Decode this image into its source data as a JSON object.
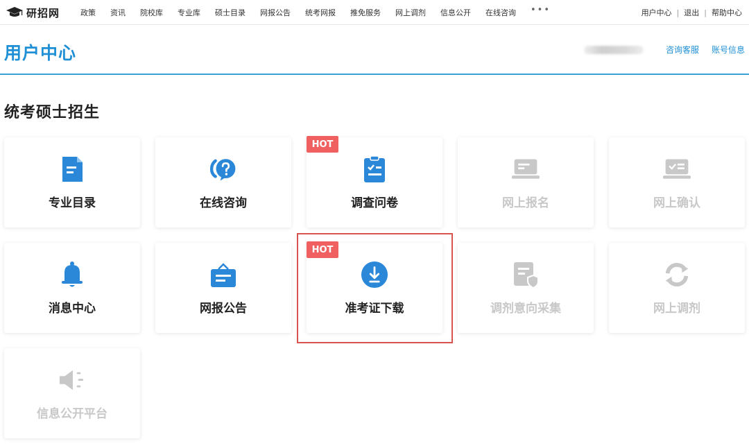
{
  "topnav": {
    "logo_text": "研招网",
    "items": [
      "政策",
      "资讯",
      "院校库",
      "专业库",
      "硕士目录",
      "网报公告",
      "统考网报",
      "推免服务",
      "网上调剂",
      "信息公开",
      "在线咨询"
    ],
    "more": "•••",
    "right": [
      "用户中心",
      "退出",
      "帮助中心"
    ],
    "separator": "|"
  },
  "header": {
    "title": "用户中心",
    "links": [
      "咨询客服",
      "账号信息"
    ]
  },
  "section": {
    "title": "统考硕士招生"
  },
  "cards": [
    {
      "label": "专业目录",
      "icon": "document-icon",
      "enabled": true,
      "hot": false
    },
    {
      "label": "在线咨询",
      "icon": "question-chat-icon",
      "enabled": true,
      "hot": false
    },
    {
      "label": "调查问卷",
      "icon": "clipboard-check-icon",
      "enabled": true,
      "hot": true
    },
    {
      "label": "网上报名",
      "icon": "laptop-icon",
      "enabled": false,
      "hot": false
    },
    {
      "label": "网上确认",
      "icon": "screen-check-icon",
      "enabled": false,
      "hot": false
    },
    {
      "label": "消息中心",
      "icon": "bell-icon",
      "enabled": true,
      "hot": false
    },
    {
      "label": "网报公告",
      "icon": "notice-board-icon",
      "enabled": true,
      "hot": false
    },
    {
      "label": "准考证下载",
      "icon": "download-icon",
      "enabled": true,
      "hot": true,
      "highlighted": true
    },
    {
      "label": "调剂意向采集",
      "icon": "doc-shield-icon",
      "enabled": false,
      "hot": false
    },
    {
      "label": "网上调剂",
      "icon": "refresh-icon",
      "enabled": false,
      "hot": false
    },
    {
      "label": "信息公开平台",
      "icon": "speaker-icon",
      "enabled": false,
      "hot": false
    }
  ],
  "hot_label": "HOT",
  "colors": {
    "accent": "#1f8fd6",
    "icon_blue": "#2b87d8",
    "icon_gray": "#c8c8c8",
    "hot": "#f06060",
    "highlight_border": "#d9534f"
  }
}
